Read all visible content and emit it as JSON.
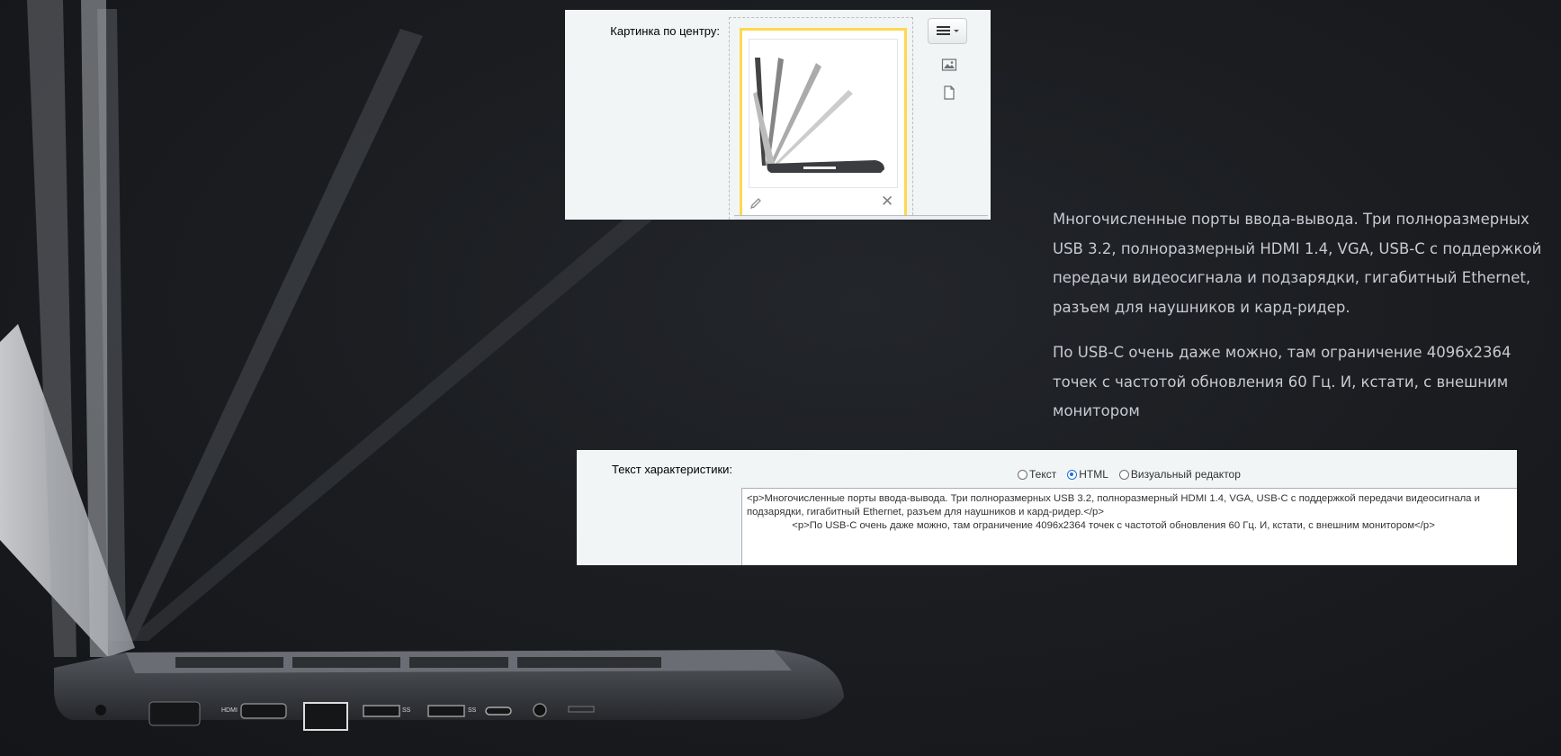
{
  "image_field": {
    "label": "Картинка по центру:",
    "menu_icon": "hamburger-dropdown-icon",
    "icons": [
      "image-icon",
      "file-icon",
      "pencil-icon",
      "close-icon"
    ],
    "delete_glyph": "✕"
  },
  "description": {
    "paragraphs": [
      "Многочисленные порты ввода-вывода. Три полноразмерных USB 3.2, полноразмерный HDMI 1.4, VGA, USB-C с поддержкой передачи видеосигнала и подзарядки, гигабитный Ethernet, разъем для наушников и кард-ридер.",
      "По USB-C очень даже можно, там ограничение 4096x2364 точек с частотой обновления 60 Гц. И, кстати, с внешним монитором"
    ]
  },
  "text_field": {
    "label": "Текст характеристики:",
    "modes": [
      {
        "label": "Текст",
        "checked": false
      },
      {
        "label": "HTML",
        "checked": true
      },
      {
        "label": "Визуальный редактор",
        "checked": false
      }
    ],
    "value": "<p>Многочисленные порты ввода-вывода. Три полноразмерных USB 3.2, полноразмерный HDMI 1.4, VGA, USB-C с поддержкой передачи видеосигнала и подзарядки, гигабитный Ethernet, разъем для наушников и кард-ридер.</p>\n\t\t<p>По USB-C очень даже можно, там ограничение 4096x2364 точек с частотой обновления 60 Гц. И, кстати, с внешним монитором</p>"
  },
  "port_labels": [
    "HDMI",
    "SS",
    "SS"
  ],
  "colors": {
    "background": "#1b1d21",
    "panel": "#f2f5f6",
    "highlight_border": "#ffd84d",
    "description_text": "#c7cad0",
    "radio_accent": "#1d6fd6"
  }
}
